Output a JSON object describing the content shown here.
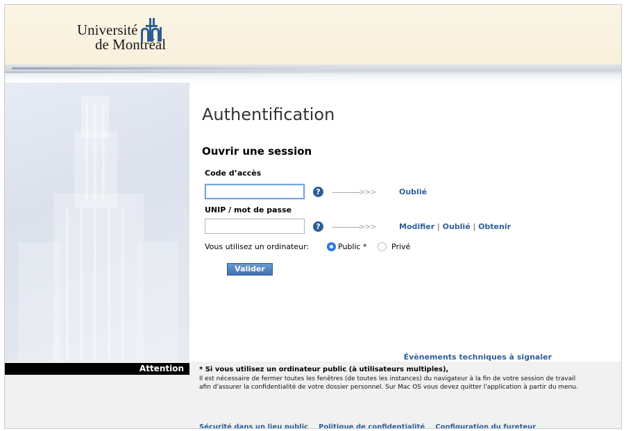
{
  "header": {
    "logo_line1": "Université",
    "logo_line2": "de Montréal"
  },
  "main": {
    "title": "Authentification",
    "section_title": "Ouvrir une session",
    "code_label": "Code d’accès",
    "code_value": "",
    "code_links": {
      "forgot": "Oublié"
    },
    "password_label": "UNIP / mot de passe",
    "password_value": "",
    "password_links": {
      "modify": "Modifier",
      "forgot": "Oublié",
      "obtain": "Obtenir",
      "separator": "|"
    },
    "arrows": ">>>",
    "help_symbol": "?",
    "computer_question": "Vous utilisez un ordinateur:",
    "radio_options": [
      {
        "label": "Public *",
        "selected": true
      },
      {
        "label": "Privé",
        "selected": false
      }
    ],
    "submit_label": "Valider",
    "events_link": "Évènements techniques à signaler"
  },
  "attention": {
    "label": "Attention",
    "heading": "* Si vous utilisez un ordinateur public (à utilisateurs multiples),",
    "body": "Il est nécessaire de fermer toutes les fenêtres (de toutes les instances) du navigateur à la fin de votre session de travail afin d'assurer la confidentialité de votre dossier personnel. Sur Mac OS vous devez quitter l'application à partir du menu.",
    "links": [
      "Sécurité dans un lieu public",
      "Politique de confidentialité",
      "Configuration du fureteur"
    ]
  },
  "colors": {
    "link": "#2f5f99",
    "logo_blue": "#2d5e93",
    "header_bg": "#fbf5e6",
    "radio_selected": "#2d7de3",
    "button": "#3f70b0",
    "attention_bar": "#000000"
  },
  "icons": {
    "logo": "udem-logo-icon",
    "help": "help-icon"
  }
}
